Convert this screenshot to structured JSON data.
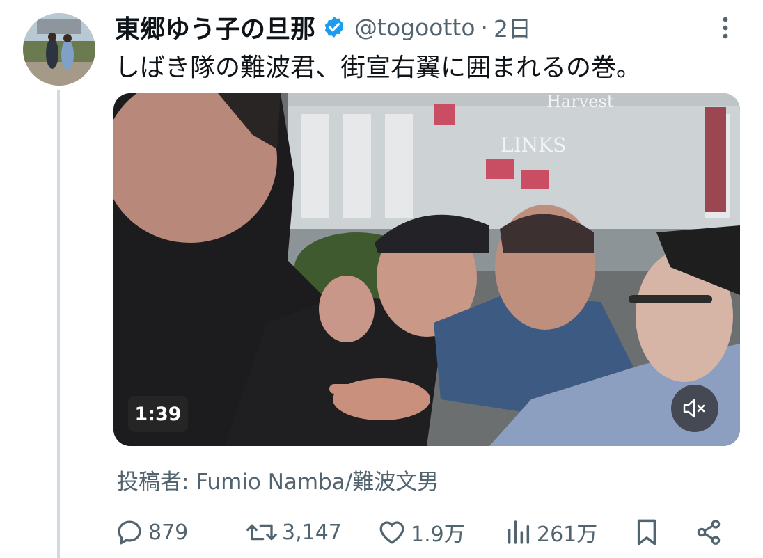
{
  "tweet": {
    "author_name": "東郷ゆう子の旦那",
    "handle": "@togootto",
    "separator": "·",
    "time": "2日",
    "text": "しばき隊の難波君、街宣右翼に囲まれるの巻。"
  },
  "media": {
    "duration": "1:39",
    "building_sign_1": "Harvest",
    "building_sign_2": "LINKS",
    "credit": "投稿者: Fumio Namba/難波文男"
  },
  "actions": {
    "replies": "879",
    "retweets": "3,147",
    "likes": "1.9万",
    "views": "261万"
  },
  "colors": {
    "verified": "#1d9bf0",
    "secondary_text": "#536471",
    "thread_line": "#cfd9de"
  }
}
